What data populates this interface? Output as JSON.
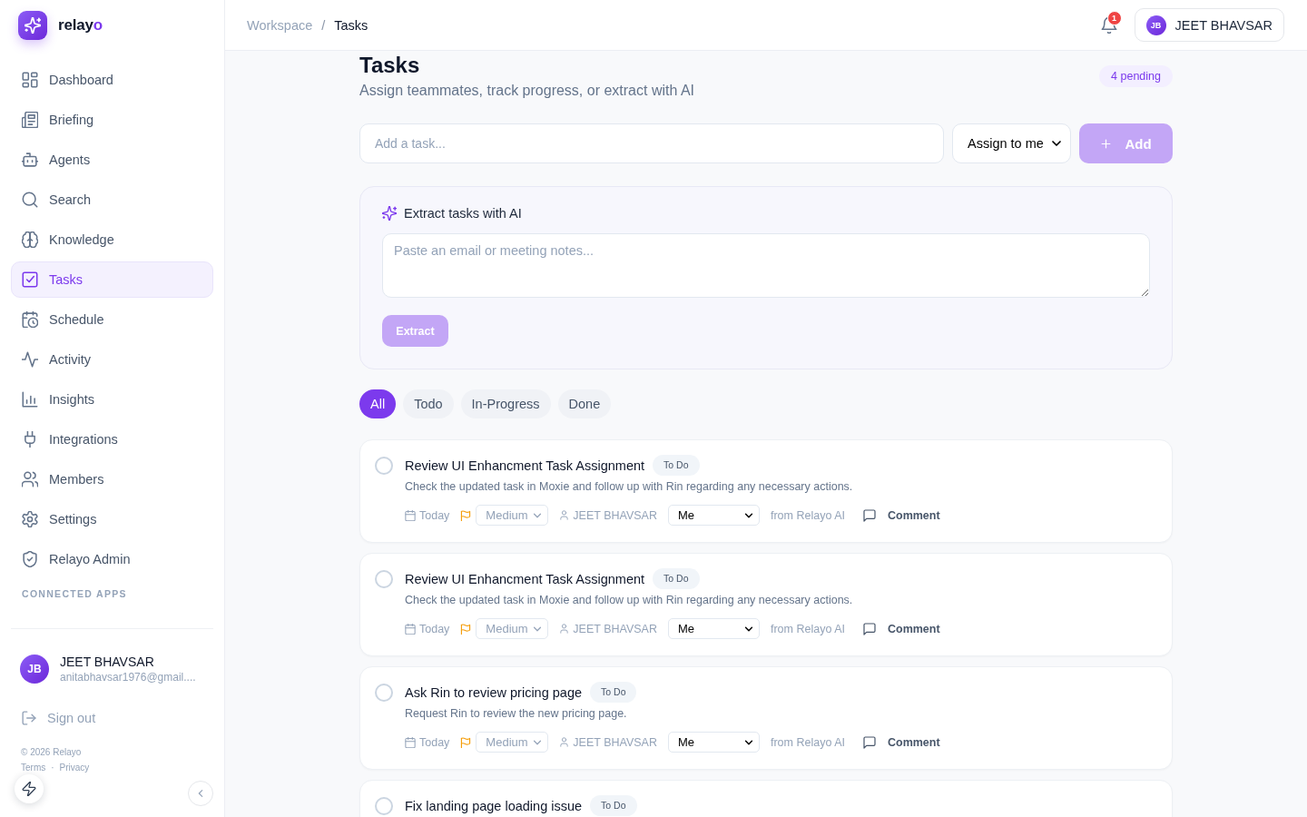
{
  "sidebar": {
    "brand": {
      "name": "relay",
      "accent": "o"
    },
    "nav": [
      {
        "label": "Dashboard",
        "selected": false
      },
      {
        "label": "Briefing",
        "selected": false
      },
      {
        "label": "Agents",
        "selected": false
      },
      {
        "label": "Search",
        "selected": false
      },
      {
        "label": "Knowledge",
        "selected": false
      },
      {
        "label": "Tasks",
        "selected": true
      },
      {
        "label": "Schedule",
        "selected": false
      },
      {
        "label": "Activity",
        "selected": false
      },
      {
        "label": "Insights",
        "selected": false
      },
      {
        "label": "Integrations",
        "selected": false
      },
      {
        "label": "Members",
        "selected": false
      },
      {
        "label": "Settings",
        "selected": false
      },
      {
        "label": "Relayo Admin",
        "selected": false
      }
    ],
    "section_label": "CONNECTED APPS",
    "user": {
      "initials": "JB",
      "name": "JEET BHAVSAR",
      "email": "anitabhavsar1976@gmail...."
    },
    "sign_out": "Sign out",
    "footer": {
      "copyright": "© 2026 Relayo",
      "links": [
        "Terms",
        "Privacy"
      ],
      "separator": "·"
    }
  },
  "header": {
    "breadcrumb": [
      {
        "label": "Workspace",
        "current": false
      },
      {
        "label": "Tasks",
        "current": true
      }
    ],
    "breadcrumb_separator": "/",
    "notifications": {
      "count": "1"
    },
    "user": {
      "initials": "JB",
      "name": "JEET BHAVSAR"
    }
  },
  "page": {
    "title": "Tasks",
    "subtitle": "Assign teammates, track progress, or extract with AI",
    "pending_badge": "4 pending"
  },
  "add_task": {
    "placeholder": "Add a task...",
    "assignee": "Assign to me",
    "button": {
      "label": "Add",
      "disabled": true
    }
  },
  "extract": {
    "title": "Extract tasks with AI",
    "placeholder": "Paste an email or meeting notes...",
    "button": {
      "label": "Extract",
      "disabled": true
    }
  },
  "filters": [
    {
      "label": "All",
      "selected": true
    },
    {
      "label": "Todo",
      "selected": false
    },
    {
      "label": "In-Progress",
      "selected": false
    },
    {
      "label": "Done",
      "selected": false
    }
  ],
  "tasks": [
    {
      "title": "Review UI Enhancment Task Assignment",
      "status": "To Do",
      "done": false,
      "description": "Check the updated task in Moxie and follow up with Rin regarding any necessary actions.",
      "due": "Today",
      "priority": "Medium",
      "owner": "JEET BHAVSAR",
      "assignee": "Me",
      "source": "from Relayo AI",
      "comment": "Comment"
    },
    {
      "title": "Review UI Enhancment Task Assignment",
      "status": "To Do",
      "done": false,
      "description": "Check the updated task in Moxie and follow up with Rin regarding any necessary actions.",
      "due": "Today",
      "priority": "Medium",
      "owner": "JEET BHAVSAR",
      "assignee": "Me",
      "source": "from Relayo AI",
      "comment": "Comment"
    },
    {
      "title": "Ask Rin to review pricing page",
      "status": "To Do",
      "done": false,
      "description": "Request Rin to review the new pricing page.",
      "due": "Today",
      "priority": "Medium",
      "owner": "JEET BHAVSAR",
      "assignee": "Me",
      "source": "from Relayo AI",
      "comment": "Comment"
    },
    {
      "title": "Fix landing page loading issue",
      "status": "To Do",
      "done": false
    }
  ]
}
